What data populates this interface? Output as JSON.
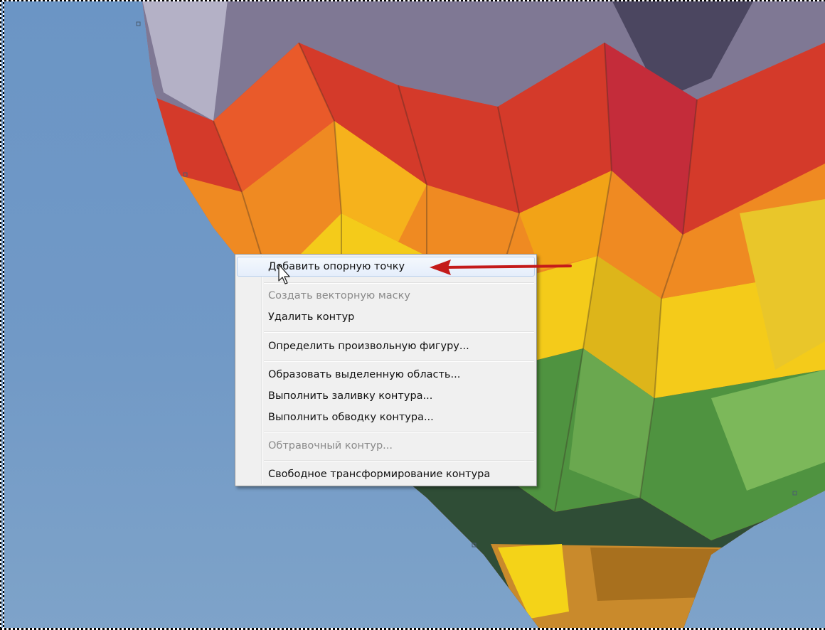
{
  "context_menu": {
    "items": [
      {
        "label": "Добавить опорную точку",
        "disabled": false,
        "highlighted": true
      },
      {
        "label": "Создать векторную маску",
        "disabled": true
      },
      {
        "label": "Удалить контур",
        "disabled": false
      },
      {
        "label": "Определить произвольную фигуру...",
        "disabled": false
      },
      {
        "label": "Образовать выделенную область...",
        "disabled": false
      },
      {
        "label": "Выполнить заливку контура...",
        "disabled": false
      },
      {
        "label": "Выполнить обводку контура...",
        "disabled": false
      },
      {
        "label": "Обтравочный контур...",
        "disabled": true
      },
      {
        "label": "Свободное трансформирование контура",
        "disabled": false
      }
    ]
  },
  "colors": {
    "sky": "#6f98c6",
    "menu_bg": "#f0f0f0",
    "arrow": "#c41a1a",
    "disabled_text": "#8a8a8a"
  },
  "icons": [
    "arrow-cursor-icon",
    "red-pointer-arrow-icon"
  ]
}
